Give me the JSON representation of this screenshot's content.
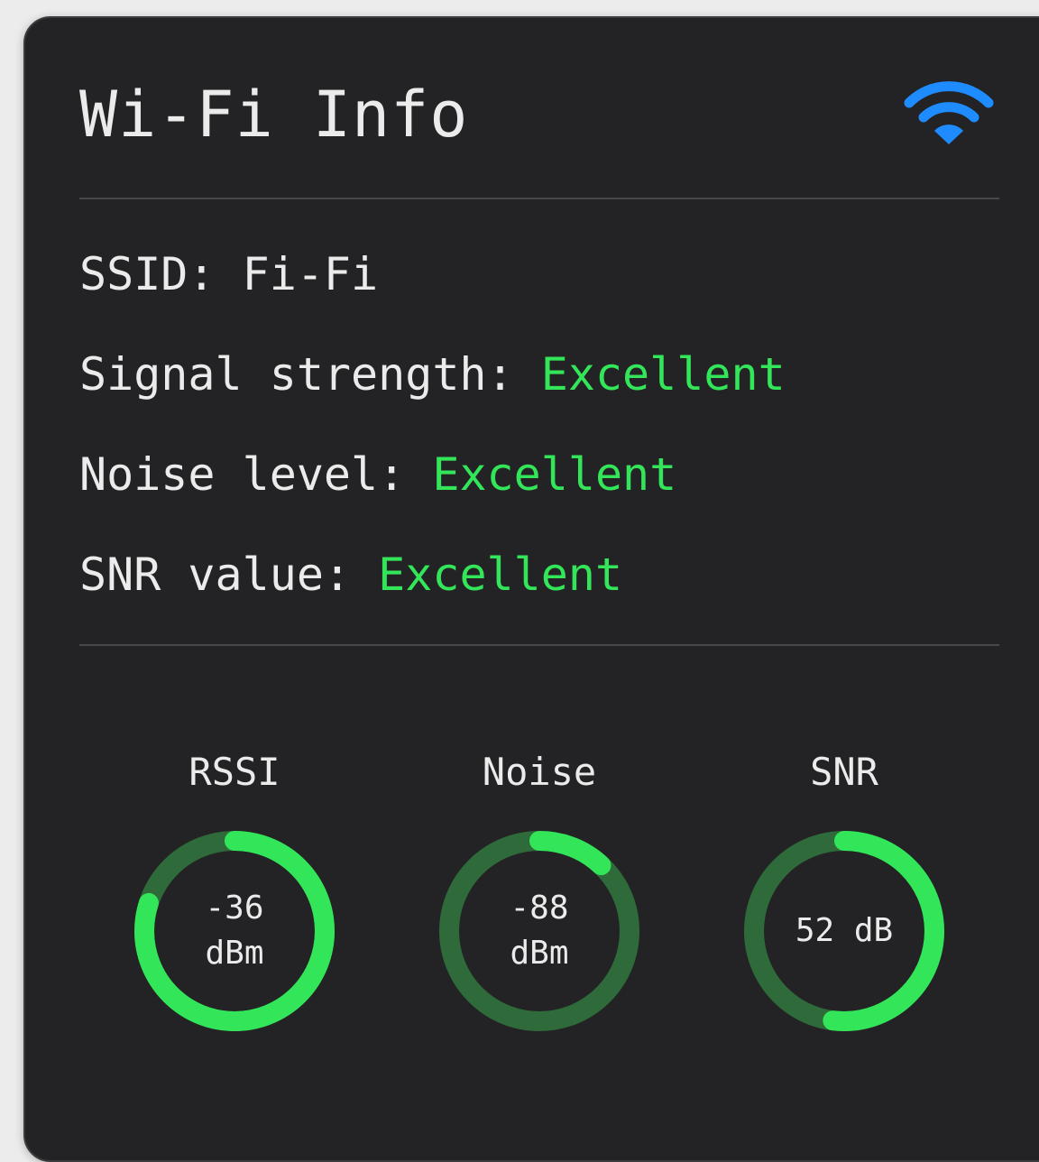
{
  "header": {
    "title": "Wi-Fi Info"
  },
  "icons": {
    "header_icon": "wifi-icon"
  },
  "colors": {
    "accent_good": "#33e659",
    "gauge_track": "#2f6b3a",
    "wifi_blue": "#1e8cff"
  },
  "info": {
    "ssid_label": "SSID:",
    "ssid_value": "Fi-Fi",
    "signal_label": "Signal strength:",
    "signal_value": "Excellent",
    "noise_label": "Noise level:",
    "noise_value": "Excellent",
    "snr_label": "SNR value:",
    "snr_value": "Excellent"
  },
  "gauges": [
    {
      "label": "RSSI",
      "value_line1": "-36",
      "value_line2": "dBm",
      "fill_fraction": 0.8
    },
    {
      "label": "Noise",
      "value_line1": "-88",
      "value_line2": "dBm",
      "fill_fraction": 0.12
    },
    {
      "label": "SNR",
      "value_line1": "52 dB",
      "value_line2": "",
      "fill_fraction": 0.52
    }
  ]
}
